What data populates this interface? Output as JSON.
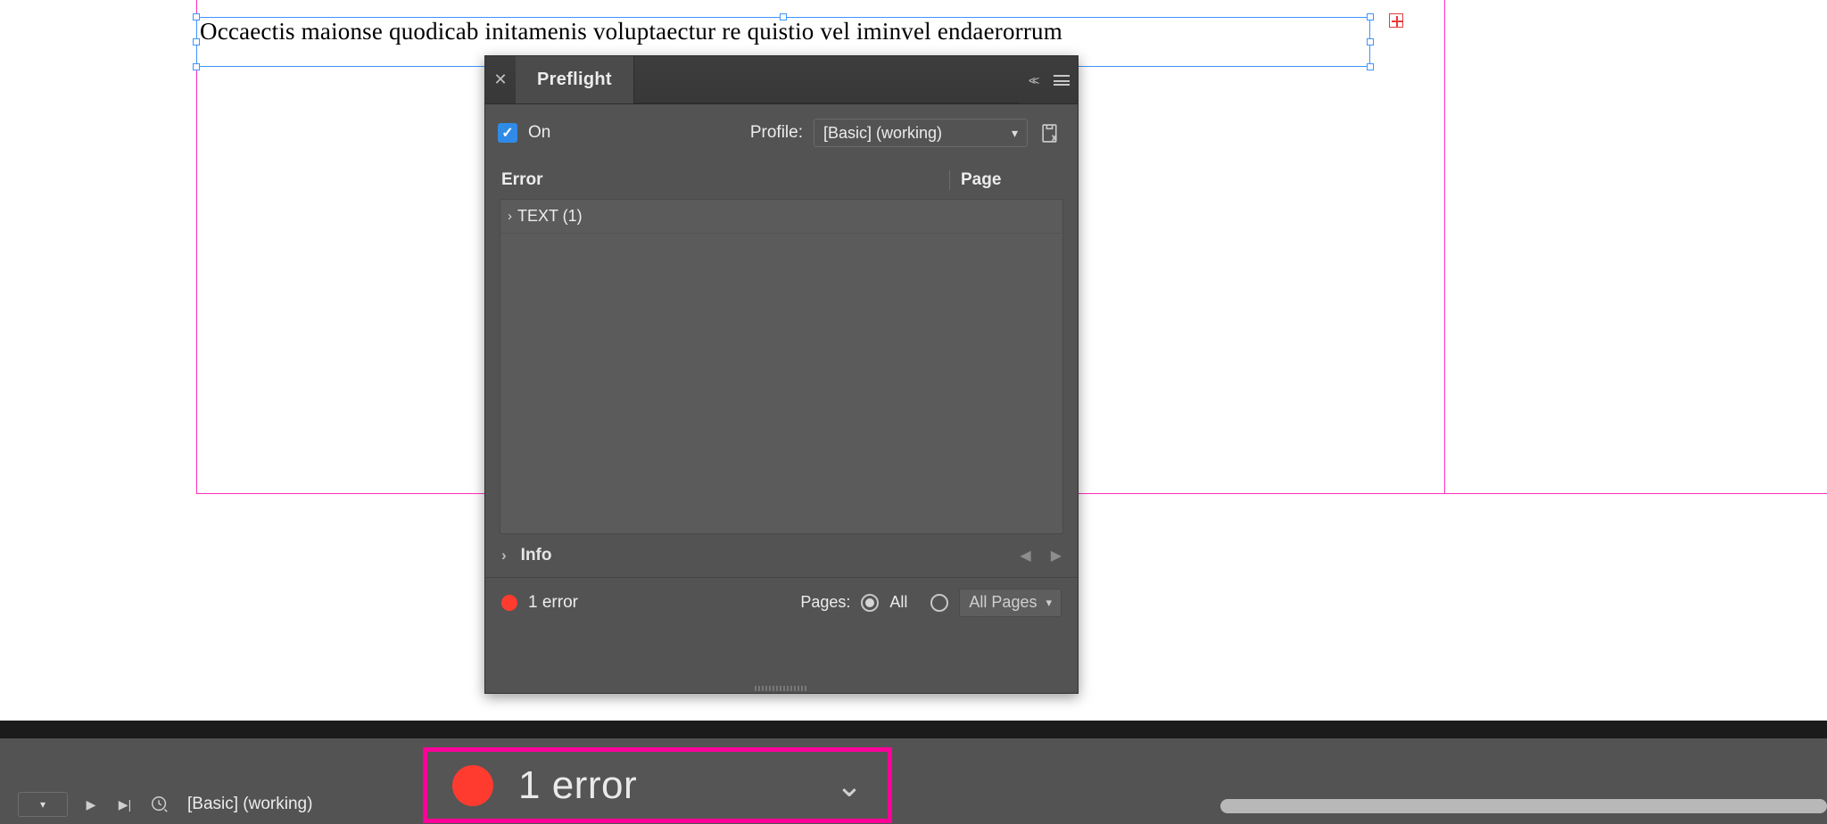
{
  "document": {
    "text": "Occaectis maionse quodicab initamenis voluptaectur re quistio vel iminvel endaerorrum",
    "baseline_marker": "0"
  },
  "panel": {
    "title": "Preflight",
    "on_label": "On",
    "profile_label": "Profile:",
    "profile_value": "[Basic] (working)",
    "headers": {
      "error": "Error",
      "page": "Page"
    },
    "list": {
      "item_label": "TEXT (1)"
    },
    "info_label": "Info",
    "status_text": "1 error",
    "pages_label": "Pages:",
    "radio_all_label": "All",
    "range_label": "All Pages"
  },
  "statusbar": {
    "profile_name": "[Basic] (working)",
    "error_text": "1 error"
  }
}
